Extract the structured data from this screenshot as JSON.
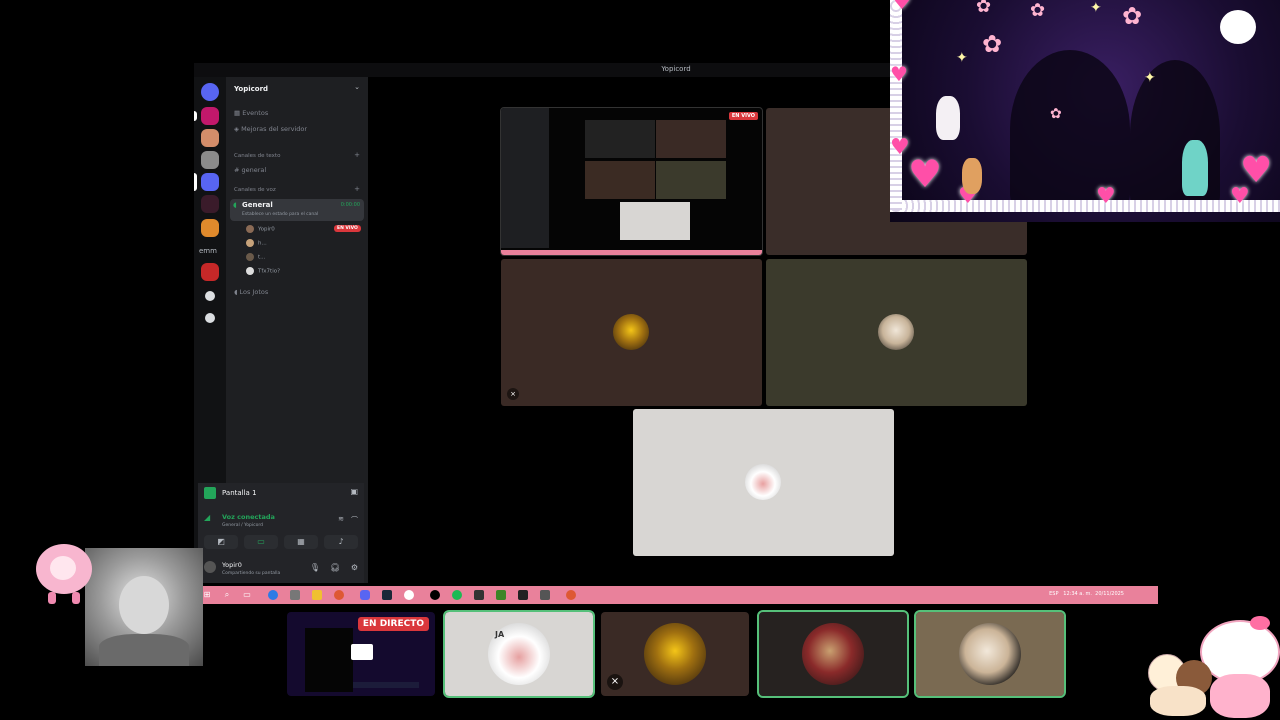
{
  "window": {
    "title": "Yopicord"
  },
  "guilds": {
    "text_item": "emm",
    "add_icon": "+",
    "explore_icon": "compass"
  },
  "sidebar": {
    "server_name": "Yopicord",
    "events": "Eventos",
    "boosts": "Mejoras del servidor",
    "text_header": "Canales de texto",
    "text_channel": "general",
    "voice_header": "Canales de voz",
    "voice_channel": "General",
    "voice_time": "0:00:00",
    "voice_status": "Establece un estado para el canal",
    "users": [
      {
        "name": "Yopir0",
        "live": "EN VIVO"
      },
      {
        "name": "h..."
      },
      {
        "name": "t..."
      },
      {
        "name": "Tfx7tio?"
      }
    ],
    "other_voice": "Los Jotos"
  },
  "panel": {
    "screen_title": "Pantalla 1",
    "voice_connected": "Voz conectada",
    "voice_location": "General / Yopicord",
    "user_name": "Yopir0",
    "user_status": "Compartiendo su pantalla"
  },
  "stage": {
    "live_badge": "EN VIVO"
  },
  "taskbar": {
    "lang": "ESP",
    "time": "12:34 a. m.",
    "date": "20/11/2025"
  },
  "thumbnails": [
    {
      "badge": "EN DIRECTO"
    },
    {
      "label": "JA"
    },
    {
      "muted": true
    },
    {
      "label": ""
    },
    {
      "label": ""
    }
  ],
  "colors": {
    "discord_bg": "#1e1f22",
    "green": "#23a55a",
    "live_red": "#da373c",
    "taskbar_pink": "#e9819b"
  }
}
